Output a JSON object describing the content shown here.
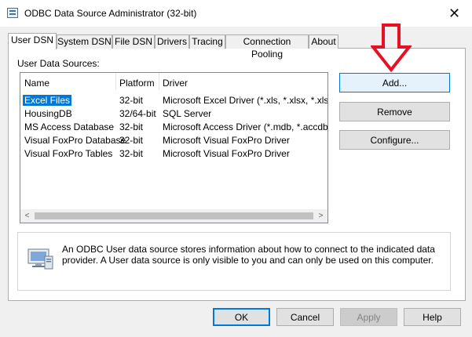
{
  "window": {
    "title": "ODBC Data Source Administrator (32-bit)",
    "close_glyph": "✕"
  },
  "tabs": [
    {
      "label": "User DSN",
      "active": true
    },
    {
      "label": "System DSN",
      "active": false
    },
    {
      "label": "File DSN",
      "active": false
    },
    {
      "label": "Drivers",
      "active": false
    },
    {
      "label": "Tracing",
      "active": false
    },
    {
      "label": "Connection Pooling",
      "active": false
    },
    {
      "label": "About",
      "active": false
    }
  ],
  "user_dsn": {
    "group_label": "User Data Sources:",
    "columns": [
      "Name",
      "Platform",
      "Driver"
    ],
    "rows": [
      {
        "name": "Excel Files",
        "platform": "32-bit",
        "driver": "Microsoft Excel Driver (*.xls, *.xlsx, *.xlsm, *.xlsb)",
        "selected": true
      },
      {
        "name": "HousingDB",
        "platform": "32/64-bit",
        "driver": "SQL Server",
        "selected": false
      },
      {
        "name": "MS Access Database",
        "platform": "32-bit",
        "driver": "Microsoft Access Driver (*.mdb, *.accdb)",
        "selected": false
      },
      {
        "name": "Visual FoxPro Database",
        "platform": "32-bit",
        "driver": "Microsoft Visual FoxPro Driver",
        "selected": false
      },
      {
        "name": "Visual FoxPro Tables",
        "platform": "32-bit",
        "driver": "Microsoft Visual FoxPro Driver",
        "selected": false
      }
    ],
    "scroll_left": "<",
    "scroll_right": ">",
    "buttons": {
      "add": "Add...",
      "remove": "Remove",
      "configure": "Configure..."
    },
    "info_text": "An ODBC User data source stores information about how to connect to the indicated data provider.   A User data source is only visible to you and can only be used on this computer."
  },
  "footer_buttons": {
    "ok": "OK",
    "cancel": "Cancel",
    "apply": "Apply",
    "help": "Help"
  },
  "colors": {
    "selection": "#0078d7",
    "annotation_arrow": "#e81123"
  }
}
